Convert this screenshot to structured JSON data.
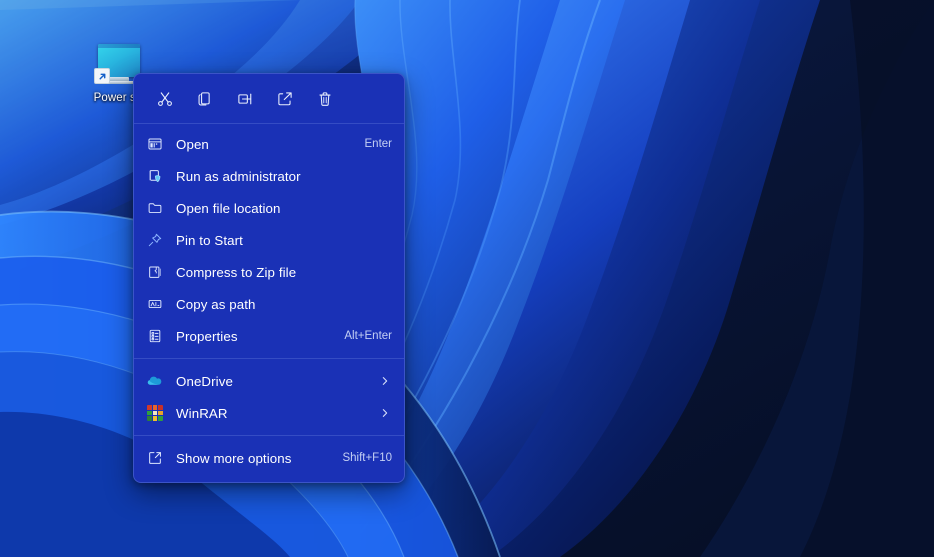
{
  "desktop": {
    "icon": {
      "name": "monitor-shortcut-icon",
      "label": "Power sa",
      "full_label": "Power saver",
      "badge": "shortcut-arrow"
    },
    "wallpaper": {
      "name": "windows-11-bloom-wallpaper",
      "colors": {
        "deep_navy": "#06132b",
        "dark_blue": "#0b1f4d",
        "mid_blue": "#1b52d6",
        "bright_blue": "#2f7ff5",
        "highlight_cyan": "#5ab6ff"
      }
    }
  },
  "context_menu": {
    "name": "file-shortcut-context-menu",
    "background": "#1a31b6",
    "toolbar": [
      {
        "id": "cut",
        "icon": "scissors-icon",
        "tooltip": "Cut"
      },
      {
        "id": "copy",
        "icon": "copy-icon",
        "tooltip": "Copy"
      },
      {
        "id": "rename",
        "icon": "rename-icon",
        "tooltip": "Rename"
      },
      {
        "id": "share",
        "icon": "share-icon",
        "tooltip": "Share"
      },
      {
        "id": "delete",
        "icon": "trash-icon",
        "tooltip": "Delete"
      }
    ],
    "groups": [
      {
        "id": "main",
        "items": [
          {
            "id": "open",
            "label": "Open",
            "accel": "Enter",
            "icon": "app-window-icon",
            "submenu": false
          },
          {
            "id": "run-as-admin",
            "label": "Run as administrator",
            "accel": "",
            "icon": "shield-icon",
            "submenu": false
          },
          {
            "id": "open-file-loc",
            "label": "Open file location",
            "accel": "",
            "icon": "folder-icon",
            "submenu": false
          },
          {
            "id": "pin-to-start",
            "label": "Pin to Start",
            "accel": "",
            "icon": "pin-icon",
            "submenu": false
          },
          {
            "id": "compress-zip",
            "label": "Compress to Zip file",
            "accel": "",
            "icon": "zip-folder-icon",
            "submenu": false
          },
          {
            "id": "copy-as-path",
            "label": "Copy as path",
            "accel": "",
            "icon": "copy-path-icon",
            "submenu": false
          },
          {
            "id": "properties",
            "label": "Properties",
            "accel": "Alt+Enter",
            "icon": "properties-icon",
            "submenu": false
          }
        ]
      },
      {
        "id": "apps",
        "items": [
          {
            "id": "onedrive",
            "label": "OneDrive",
            "accel": "",
            "icon": "onedrive-cloud-icon",
            "submenu": true
          },
          {
            "id": "winrar",
            "label": "WinRAR",
            "accel": "",
            "icon": "winrar-icon",
            "submenu": true
          }
        ]
      },
      {
        "id": "more",
        "items": [
          {
            "id": "show-more-options",
            "label": "Show more options",
            "accel": "Shift+F10",
            "icon": "expand-icon",
            "submenu": false
          }
        ]
      }
    ]
  }
}
